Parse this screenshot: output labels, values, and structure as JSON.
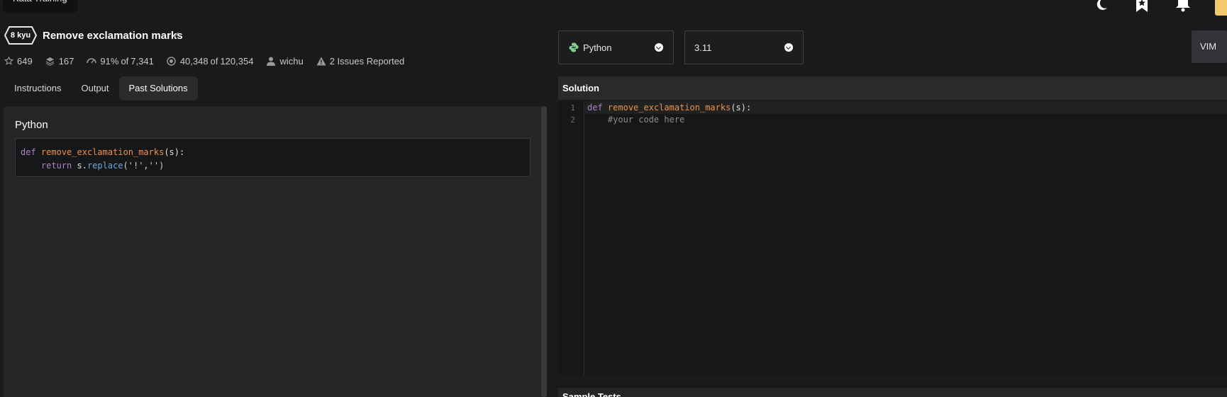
{
  "topbar": {
    "training_chip": "Kata Training",
    "icons": [
      "moon-icon",
      "bookmark-star-icon",
      "bell-icon"
    ]
  },
  "kata": {
    "rank": "8 kyu",
    "title": "Remove exclamation marks",
    "completed_mark": "✓",
    "stats": {
      "stars": "649",
      "collections": "167",
      "satisfaction": "91%",
      "of_label": "of",
      "votes": "7,341",
      "completed": "40,348",
      "attempted": "120,354",
      "author": "wichu",
      "issues": "2 Issues Reported"
    }
  },
  "tabs": [
    {
      "label": "Instructions",
      "active": false
    },
    {
      "label": "Output",
      "active": false
    },
    {
      "label": "Past Solutions",
      "active": true
    }
  ],
  "past_solution": {
    "language": "Python",
    "code": [
      {
        "kw": "def",
        "fn": "remove_exclamation_marks",
        "rest": "(s):"
      },
      {
        "indent": "    ",
        "kw": "return",
        "obj": " s.",
        "mth": "replace",
        "args": "('!','')"
      }
    ]
  },
  "editor_controls": {
    "language": "Python",
    "version": "3.11",
    "vim_label": "VIM"
  },
  "solution": {
    "header": "Solution",
    "lines": [
      {
        "num": "1",
        "kw": "def",
        "fn": "remove_exclamation_marks",
        "rest": "(s):"
      },
      {
        "num": "2",
        "comment": "    #your code here"
      }
    ]
  },
  "sample_tests": {
    "header": "Sample Tests"
  },
  "colors": {
    "background": "#1a1a1c",
    "panel": "#252528",
    "keyword": "#b07fc7",
    "function": "#f08f4a",
    "method": "#6ba7e0"
  }
}
